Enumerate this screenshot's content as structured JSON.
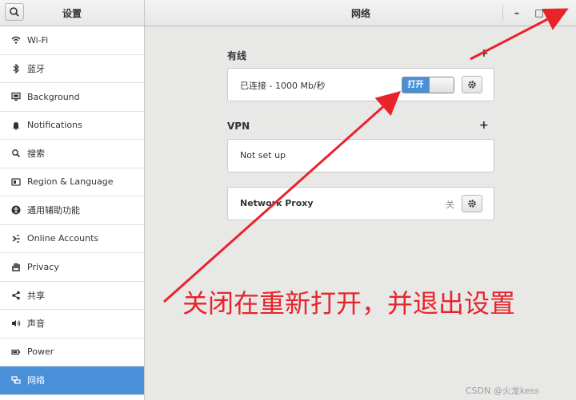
{
  "window": {
    "left_title": "设置",
    "title": "网络",
    "minimize_label": "–",
    "maximize_label": "□",
    "close_label": "✕"
  },
  "sidebar": {
    "items": [
      {
        "label": "Wi-Fi",
        "icon": "wifi-icon"
      },
      {
        "label": "蓝牙",
        "icon": "bluetooth-icon"
      },
      {
        "label": "Background",
        "icon": "background-icon"
      },
      {
        "label": "Notifications",
        "icon": "bell-icon"
      },
      {
        "label": "搜索",
        "icon": "search-icon"
      },
      {
        "label": "Region & Language",
        "icon": "region-icon"
      },
      {
        "label": "通用辅助功能",
        "icon": "accessibility-icon"
      },
      {
        "label": "Online Accounts",
        "icon": "accounts-icon"
      },
      {
        "label": "Privacy",
        "icon": "hand-icon"
      },
      {
        "label": "共享",
        "icon": "share-icon"
      },
      {
        "label": "声音",
        "icon": "speaker-icon"
      },
      {
        "label": "Power",
        "icon": "battery-icon"
      },
      {
        "label": "网络",
        "icon": "network-icon",
        "active": true
      }
    ]
  },
  "wired": {
    "title": "有线",
    "add_label": "+",
    "status": "已连接 - 1000 Mb/秒",
    "toggle_label": "打开",
    "toggle_on": true
  },
  "vpn": {
    "title": "VPN",
    "add_label": "+",
    "empty_text": "Not set up"
  },
  "proxy": {
    "label": "Network Proxy",
    "state": "关"
  },
  "annotation": {
    "text": "关闭在重新打开，并退出设置",
    "color": "#e8242a"
  },
  "watermark": "CSDN @火龙kess",
  "colors": {
    "accent": "#4a90d9",
    "annotation_red": "#e8242a"
  }
}
